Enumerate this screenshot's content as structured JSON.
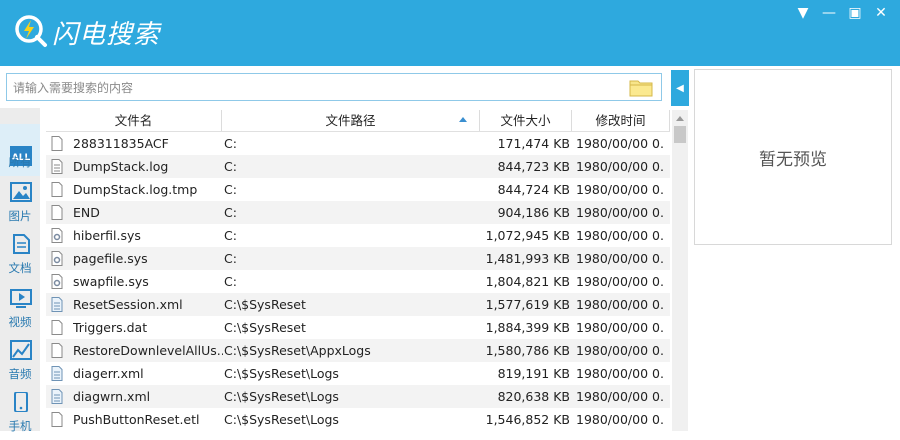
{
  "app": {
    "title": "闪电搜索",
    "accent": "#2ea9de"
  },
  "window_controls": [
    "▼",
    "—",
    "▣",
    "✕"
  ],
  "search": {
    "placeholder": "请输入需要搜索的内容",
    "value": ""
  },
  "preview": {
    "empty_text": "暂无预览"
  },
  "sidebar": {
    "items": [
      {
        "label": "所有",
        "icon": "all-icon",
        "active": true
      },
      {
        "label": "图片",
        "icon": "image-icon"
      },
      {
        "label": "文档",
        "icon": "document-icon"
      },
      {
        "label": "视频",
        "icon": "video-icon"
      },
      {
        "label": "音频",
        "icon": "audio-icon"
      },
      {
        "label": "手机",
        "icon": "phone-icon"
      }
    ]
  },
  "table": {
    "columns": [
      "文件名",
      "文件路径",
      "文件大小",
      "修改时间"
    ],
    "sorted_column": "文件路径",
    "rows": [
      {
        "name": "288311835ACF",
        "path": "C:",
        "size": "171,474 KB",
        "date": "1980/00/00 0...",
        "icon": "file-icon"
      },
      {
        "name": "DumpStack.log",
        "path": "C:",
        "size": "844,723 KB",
        "date": "1980/00/00 0...",
        "icon": "text-file-icon"
      },
      {
        "name": "DumpStack.log.tmp",
        "path": "C:",
        "size": "844,724 KB",
        "date": "1980/00/00 0...",
        "icon": "file-icon"
      },
      {
        "name": "END",
        "path": "C:",
        "size": "904,186 KB",
        "date": "1980/00/00 0...",
        "icon": "file-icon"
      },
      {
        "name": "hiberfil.sys",
        "path": "C:",
        "size": "1,072,945 KB",
        "date": "1980/00/00 0...",
        "icon": "system-file-icon"
      },
      {
        "name": "pagefile.sys",
        "path": "C:",
        "size": "1,481,993 KB",
        "date": "1980/00/00 0...",
        "icon": "system-file-icon"
      },
      {
        "name": "swapfile.sys",
        "path": "C:",
        "size": "1,804,821 KB",
        "date": "1980/00/00 0...",
        "icon": "system-file-icon"
      },
      {
        "name": "ResetSession.xml",
        "path": "C:\\$SysReset",
        "size": "1,577,619 KB",
        "date": "1980/00/00 0...",
        "icon": "xml-file-icon"
      },
      {
        "name": "Triggers.dat",
        "path": "C:\\$SysReset",
        "size": "1,884,399 KB",
        "date": "1980/00/00 0...",
        "icon": "file-icon"
      },
      {
        "name": "RestoreDownlevelAllUs...",
        "path": "C:\\$SysReset\\AppxLogs",
        "size": "1,580,786 KB",
        "date": "1980/00/00 0...",
        "icon": "file-icon"
      },
      {
        "name": "diagerr.xml",
        "path": "C:\\$SysReset\\Logs",
        "size": "819,191 KB",
        "date": "1980/00/00 0...",
        "icon": "xml-file-icon"
      },
      {
        "name": "diagwrn.xml",
        "path": "C:\\$SysReset\\Logs",
        "size": "820,638 KB",
        "date": "1980/00/00 0...",
        "icon": "xml-file-icon"
      },
      {
        "name": "PushButtonReset.etl",
        "path": "C:\\$SysReset\\Logs",
        "size": "1,546,852 KB",
        "date": "1980/00/00 0...",
        "icon": "file-icon"
      }
    ]
  }
}
